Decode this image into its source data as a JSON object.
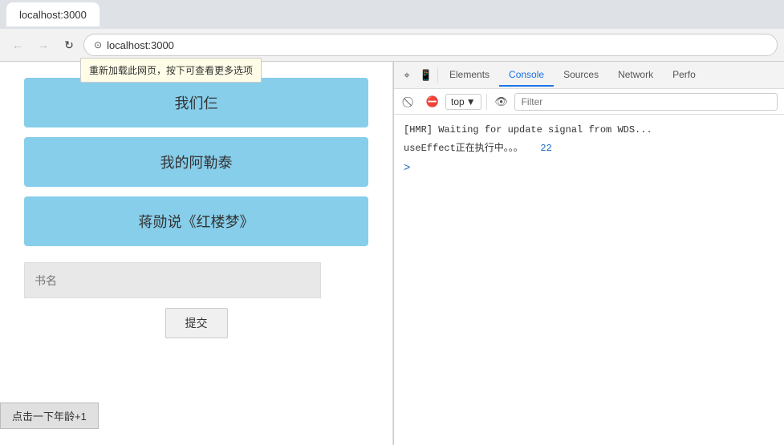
{
  "browser": {
    "back_label": "←",
    "forward_label": "→",
    "reload_label": "↻",
    "url": "localhost:3000",
    "tooltip_text": "重新加载此网页，按下可查看更多选项"
  },
  "webpage": {
    "book1_label": "我们仨",
    "book2_label": "我的阿勒泰",
    "book3_label": "蒋勋说《红楼梦》",
    "input_placeholder": "书名",
    "submit_label": "提交",
    "age_btn_label": "点击一下年龄+1"
  },
  "devtools": {
    "tabs": [
      {
        "label": "Elements",
        "active": false
      },
      {
        "label": "Console",
        "active": true
      },
      {
        "label": "Sources",
        "active": false
      },
      {
        "label": "Network",
        "active": false
      },
      {
        "label": "Perfo",
        "active": false
      }
    ],
    "toolbar": {
      "top_selector": "top",
      "filter_placeholder": "Filter"
    },
    "console": {
      "line1": "[HMR] Waiting for update signal from WDS...",
      "line2": "useEffect正在执行中。。。",
      "line2_number": "22",
      "prompt": ">"
    }
  }
}
